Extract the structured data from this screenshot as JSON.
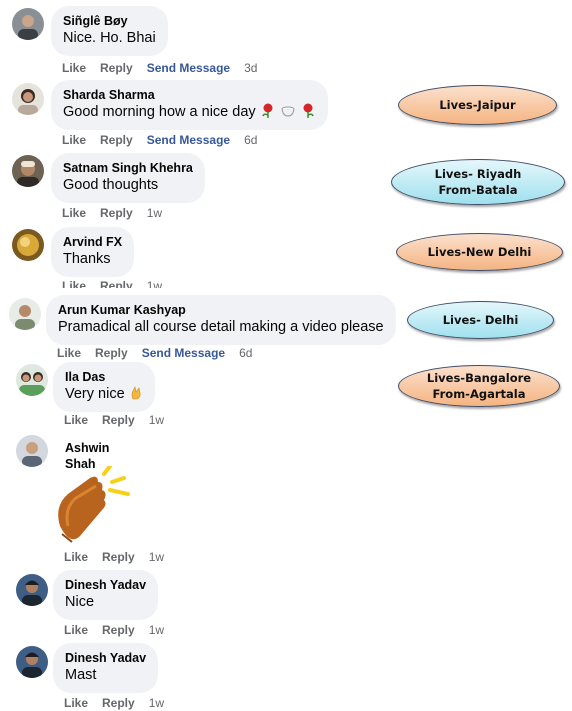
{
  "actions": {
    "like": "Like",
    "reply": "Reply",
    "send_message": "Send Message"
  },
  "comments": [
    {
      "name": "Siñglê Bøy",
      "text": "Nice. Ho. Bhai",
      "time": "3d",
      "send_message": true
    },
    {
      "name": "Sharda Sharma",
      "text": "Good morning how a nice day",
      "emojis": [
        "rose-emoji",
        "coffee-emoji",
        "rose-emoji"
      ],
      "time": "6d",
      "send_message": true
    },
    {
      "name": "Satnam Singh Khehra",
      "text": "Good thoughts",
      "time": "1w"
    },
    {
      "name": "Arvind FX",
      "text": "Thanks",
      "time": "1w"
    },
    {
      "name": "Arun Kumar Kashyap",
      "text": "Pramadical all course detail making a video please",
      "time": "6d",
      "send_message": true
    },
    {
      "name": "Ila Das",
      "text": "Very nice",
      "emojis": [
        "ok-hand-emoji"
      ],
      "time": "1w"
    },
    {
      "name": "Ashwin Shah",
      "sticker": "clapping-hands-sticker",
      "time": "1w"
    },
    {
      "name": "Dinesh Yadav",
      "text": "Nice",
      "time": "1w"
    },
    {
      "name": "Dinesh Yadav",
      "text": "Mast",
      "time": "1w"
    }
  ],
  "location_tags": [
    {
      "lines": [
        "Lives-Jaipur"
      ],
      "color": "#f5b482"
    },
    {
      "lines": [
        "Lives- Riyadh",
        "From-Batala"
      ],
      "color": "#9fe0ee"
    },
    {
      "lines": [
        "Lives-New Delhi"
      ],
      "color": "#f5b482"
    },
    {
      "lines": [
        "Lives- Delhi"
      ],
      "color": "#9fe0ee"
    },
    {
      "lines": [
        "Lives-Bangalore",
        "From-Agartala"
      ],
      "color": "#f5b482"
    }
  ]
}
